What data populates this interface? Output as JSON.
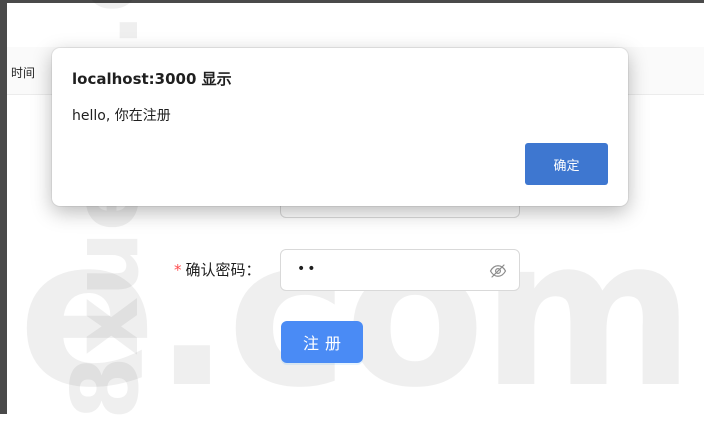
{
  "table": {
    "header_partial": "时间"
  },
  "form": {
    "confirm_label": "确认密码：",
    "required_mark": "*",
    "confirm_value": "••",
    "register_label": "注册"
  },
  "dialog": {
    "title": "localhost:3000 显示",
    "message": "hello, 你在注册",
    "ok_label": "确定"
  },
  "watermark": {
    "horizontal": "e.com",
    "vertical": "8xueke.co"
  },
  "icons": {
    "password_toggle": "eye-off-icon"
  },
  "colors": {
    "primary": "#4a8bf5",
    "dialog_button": "#3e77d0",
    "required": "#ff4d4f"
  }
}
